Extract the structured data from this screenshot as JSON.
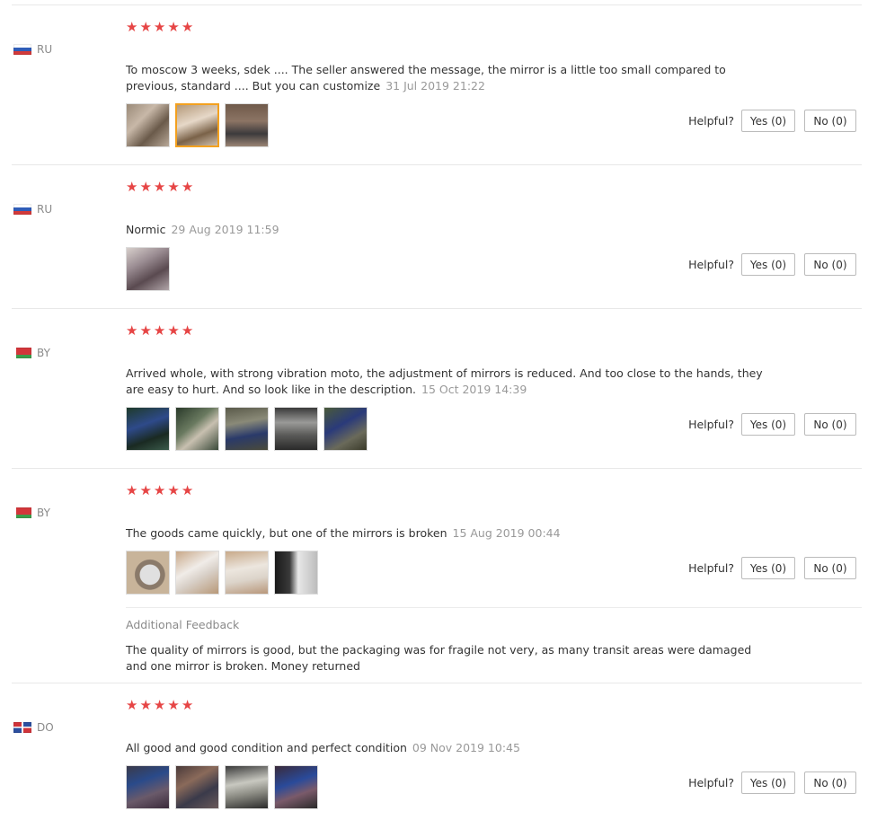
{
  "helpful_label": "Helpful?",
  "star_glyph": "★",
  "reviews": [
    {
      "country": "RU",
      "rating": 5,
      "text": "To moscow 3 weeks, sdek .... The seller answered the message, the mirror is a little too small compared to previous, standard .... But you can customize",
      "date": "31 Jul 2019 21:22",
      "yes_label": "Yes (0)",
      "no_label": "No (0)",
      "photo_count": 3
    },
    {
      "country": "RU",
      "rating": 5,
      "text": "Normic",
      "date": "29 Aug 2019 11:59",
      "yes_label": "Yes (0)",
      "no_label": "No (0)",
      "photo_count": 1
    },
    {
      "country": "BY",
      "rating": 5,
      "text": "Arrived whole, with strong vibration moto, the adjustment of mirrors is reduced. And too close to the hands, they are easy to hurt. And so look like in the description.",
      "date": "15 Oct 2019 14:39",
      "yes_label": "Yes (0)",
      "no_label": "No (0)",
      "photo_count": 5
    },
    {
      "country": "BY",
      "rating": 5,
      "text": "The goods came quickly, but one of the mirrors is broken",
      "date": "15 Aug 2019 00:44",
      "yes_label": "Yes (0)",
      "no_label": "No (0)",
      "photo_count": 4,
      "additional_feedback_title": "Additional Feedback",
      "additional_feedback": "The quality of mirrors is good, but the packaging was for fragile not very, as many transit areas were damaged and one mirror is broken. Money returned"
    },
    {
      "country": "DO",
      "rating": 5,
      "text": "All good and good condition and perfect condition",
      "date": "09 Nov 2019 10:45",
      "yes_label": "Yes (0)",
      "no_label": "No (0)",
      "photo_count": 4
    }
  ]
}
